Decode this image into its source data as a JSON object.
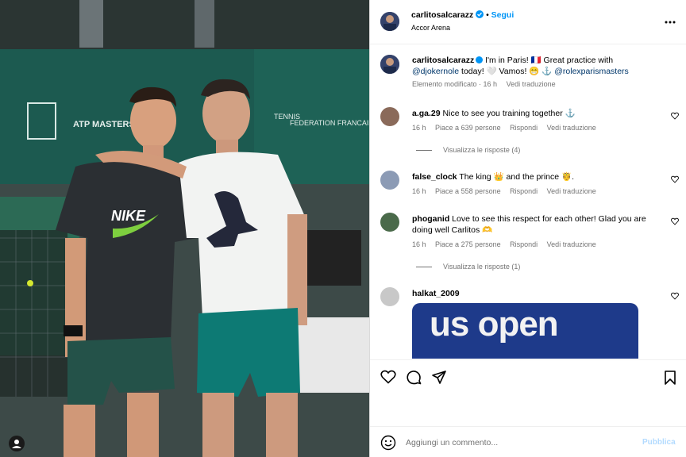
{
  "post": {
    "username": "carlitosalcarazz",
    "follow_label": "Segui",
    "location": "Accor Arena",
    "more_label": "...",
    "caption_user": "carlitosalcarazz",
    "caption_text": " I'm in Paris! 🇫🇷 Great practice with ",
    "caption_mention1": "@djokernole",
    "caption_text2": " today! 🤍 Vamos! 😁 ⚓ ",
    "caption_mention2": "@rolexparismasters",
    "caption_meta_edited": "Elemento modificato · 16 h",
    "caption_meta_translate": "Vedi traduzione"
  },
  "comments": [
    {
      "user": "a.ga.29",
      "text": " Nice to see you training together ⚓",
      "time": "16 h",
      "likes": "Piace a 639 persone",
      "reply": "Rispondi",
      "translate": "Vedi traduzione",
      "replies": "Visualizza le risposte (4)"
    },
    {
      "user": "false_clock",
      "text": " The king 👑 and the prince 🤴.",
      "time": "16 h",
      "likes": "Piace a 558 persone",
      "reply": "Rispondi",
      "translate": "Vedi traduzione",
      "replies": ""
    },
    {
      "user": "phoganid",
      "text": " Love to see this respect for each other! Glad you are doing well Carlitos 🫶",
      "time": "16 h",
      "likes": "Piace a 275 persone",
      "reply": "Rispondi",
      "translate": "Vedi traduzione",
      "replies": "Visualizza le risposte (1)"
    },
    {
      "user": "halkat_2009",
      "text": "",
      "image_text": "us open"
    }
  ],
  "compose": {
    "placeholder": "Aggiungi un commento...",
    "publish_label": "Pubblica"
  },
  "photo": {
    "shirt_text": "NIKE",
    "banner_texts": [
      "ATP MASTERS 1000",
      "TENNIS",
      "FEDERATION FRANCAISE"
    ]
  },
  "colors": {
    "link": "#0095f6",
    "muted": "#737373",
    "verified": "#0095f6"
  }
}
